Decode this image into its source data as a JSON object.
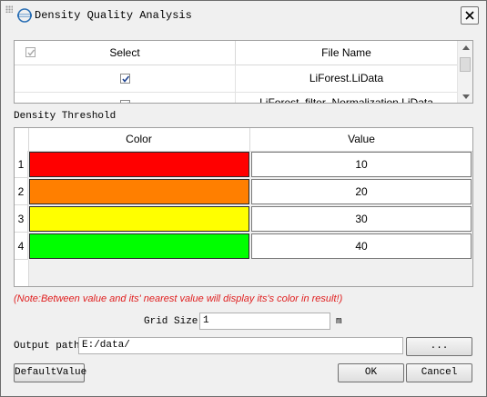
{
  "window": {
    "title": "Density Quality Analysis",
    "close_label": "×"
  },
  "file_table": {
    "headers": {
      "select": "Select",
      "file_name": "File Name"
    },
    "rows": [
      {
        "checked": true,
        "file_name": "LiForest.LiData"
      },
      {
        "checked": true,
        "file_name": "LiForest_filter_Normalization.LiData"
      }
    ]
  },
  "density_threshold": {
    "label": "Density Threshold",
    "headers": {
      "color": "Color",
      "value": "Value"
    },
    "rows": [
      {
        "index": "1",
        "color": "#ff0000",
        "value": "10"
      },
      {
        "index": "2",
        "color": "#ff7f00",
        "value": "20"
      },
      {
        "index": "3",
        "color": "#ffff00",
        "value": "30"
      },
      {
        "index": "4",
        "color": "#00ff00",
        "value": "40"
      }
    ]
  },
  "note": "(Note:Between value and its' nearest value will display its's color in result!)",
  "grid_size": {
    "label": "Grid Size",
    "value": "1",
    "unit": "m"
  },
  "output_path": {
    "label": "Output path:",
    "value": "E:/data/",
    "browse_label": "..."
  },
  "buttons": {
    "default": "DefaultValue",
    "ok": "OK",
    "cancel": "Cancel"
  }
}
